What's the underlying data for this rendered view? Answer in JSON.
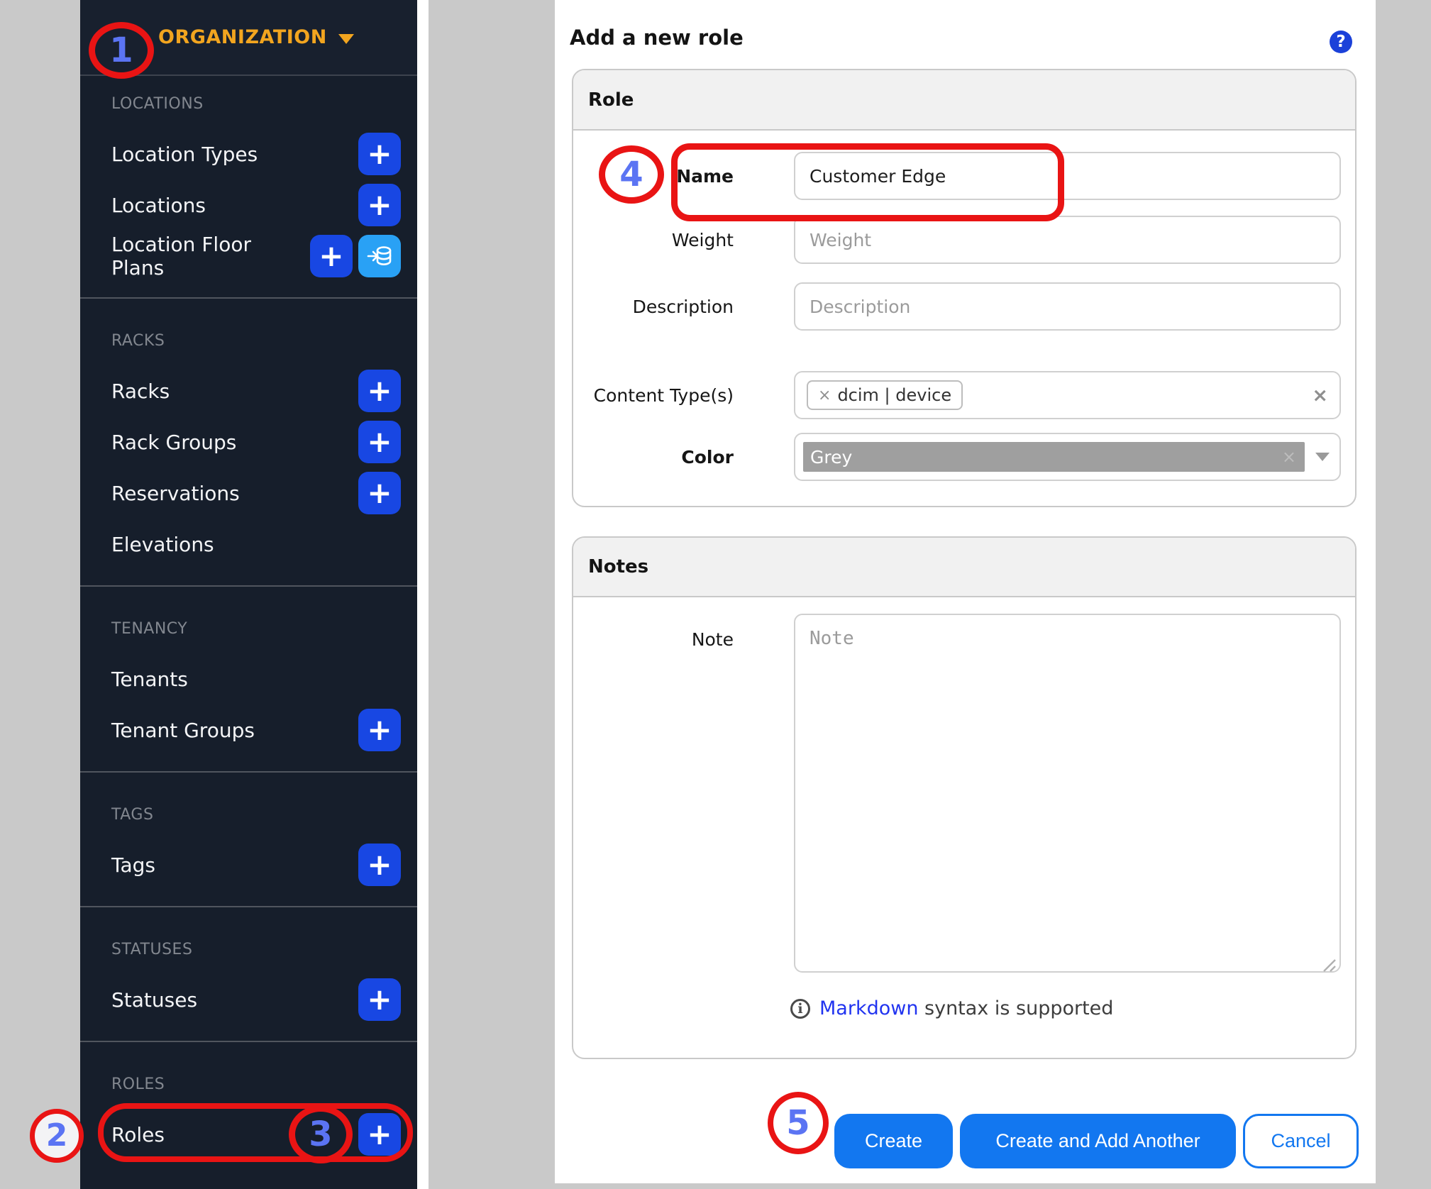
{
  "annotations": {
    "step_1": "1",
    "step_2": "2",
    "step_3": "3",
    "step_4": "4",
    "step_5": "5"
  },
  "icons": {
    "plus": "+",
    "help": "?",
    "info": "i",
    "close": "×",
    "tag_remove": "×"
  },
  "sidebar": {
    "title": "ORGANIZATION",
    "sections": [
      {
        "title": "LOCATIONS",
        "items": [
          {
            "label": "Location Types",
            "add": true
          },
          {
            "label": "Locations",
            "add": true
          },
          {
            "label": "Location Floor Plans",
            "add": true,
            "import": true
          }
        ]
      },
      {
        "title": "RACKS",
        "items": [
          {
            "label": "Racks",
            "add": true
          },
          {
            "label": "Rack Groups",
            "add": true
          },
          {
            "label": "Reservations",
            "add": true
          },
          {
            "label": "Elevations",
            "add": false
          }
        ]
      },
      {
        "title": "TENANCY",
        "items": [
          {
            "label": "Tenants",
            "add": false
          },
          {
            "label": "Tenant Groups",
            "add": true
          }
        ]
      },
      {
        "title": "TAGS",
        "items": [
          {
            "label": "Tags",
            "add": true
          }
        ]
      },
      {
        "title": "STATUSES",
        "items": [
          {
            "label": "Statuses",
            "add": true
          }
        ]
      },
      {
        "title": "ROLES",
        "items": [
          {
            "label": "Roles",
            "add": true
          }
        ]
      }
    ]
  },
  "main": {
    "title": "Add a new role",
    "role_card": {
      "title": "Role",
      "fields": {
        "name": {
          "label": "Name",
          "value": "Customer Edge"
        },
        "weight": {
          "label": "Weight",
          "placeholder": "Weight"
        },
        "description": {
          "label": "Description",
          "placeholder": "Description"
        },
        "content_types": {
          "label": "Content Type(s)",
          "tag": "dcim | device"
        },
        "color": {
          "label": "Color",
          "value": "Grey",
          "swatch_color": "#9f9f9f"
        }
      }
    },
    "notes_card": {
      "title": "Notes",
      "note": {
        "label": "Note",
        "placeholder": "Note"
      },
      "hint": {
        "link": "Markdown",
        "rest": " syntax is supported"
      }
    },
    "buttons": {
      "create": "Create",
      "create_and_add": "Create and Add Another",
      "cancel": "Cancel"
    }
  },
  "colors": {
    "accent_orange": "#f2a51f",
    "sidebar_bg": "#161e2b",
    "plus_button_blue": "#1847e3",
    "import_button_blue": "#29a1f5",
    "primary_button_blue": "#1277f0",
    "help_icon_blue": "#1b41d9",
    "annotation_red": "#e91414",
    "annotation_number_blue": "#5b74f3",
    "color_value_swatch": "#9f9f9f"
  }
}
